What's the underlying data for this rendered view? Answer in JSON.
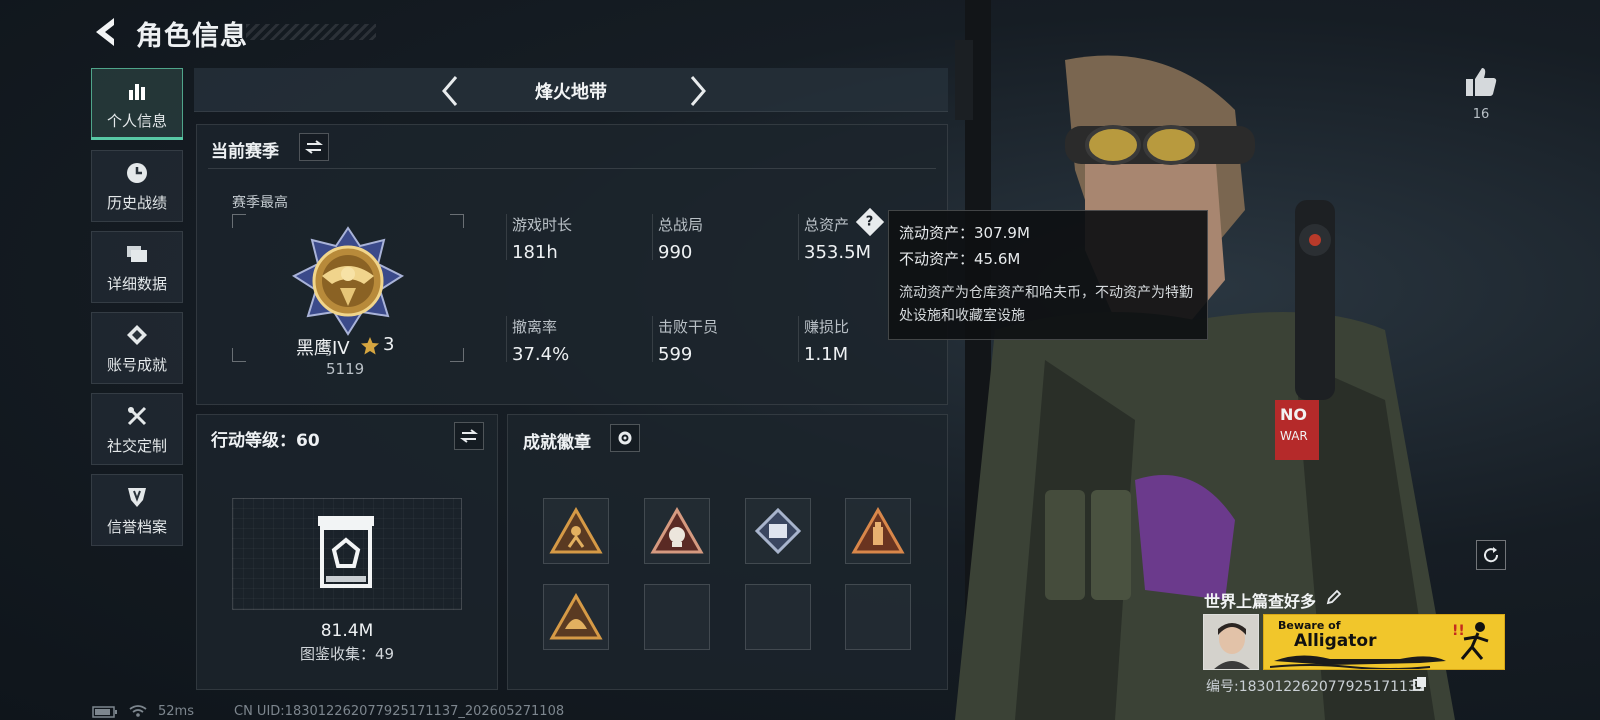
{
  "header": {
    "title": "角色信息"
  },
  "nav": [
    {
      "label": "个人信息",
      "icon": "bar-chart-icon",
      "active": true
    },
    {
      "label": "历史战绩",
      "icon": "clock-icon",
      "active": false
    },
    {
      "label": "详细数据",
      "icon": "folder-icon",
      "active": false
    },
    {
      "label": "账号成就",
      "icon": "achievement-icon",
      "active": false
    },
    {
      "label": "社交定制",
      "icon": "tools-icon",
      "active": false
    },
    {
      "label": "信誉档案",
      "icon": "shield-icon",
      "active": false
    }
  ],
  "mode": {
    "name": "烽火地带"
  },
  "season": {
    "title": "当前赛季",
    "best_label": "赛季最高",
    "rank_name": "黑鹰IV",
    "rank_stars": "3",
    "rank_points": "5119",
    "stats": [
      {
        "label": "游戏时长",
        "value": "181h"
      },
      {
        "label": "总战局",
        "value": "990"
      },
      {
        "label": "总资产",
        "value": "353.5M"
      },
      {
        "label": "撤离率",
        "value": "37.4%"
      },
      {
        "label": "击败干员",
        "value": "599"
      },
      {
        "label": "赚损比",
        "value": "1.1M"
      }
    ]
  },
  "tooltip": {
    "liquid_label": "流动资产：",
    "liquid_value": "307.9M",
    "fixed_label": "不动资产：",
    "fixed_value": "45.6M",
    "description": "流动资产为仓库资产和哈夫币，不动资产为特勤处设施和收藏室设施"
  },
  "action_level": {
    "title_label": "行动等级：",
    "level": "60",
    "value": "81.4M",
    "collection_label": "图鉴收集：",
    "collection_count": "49"
  },
  "achievements": {
    "title": "成就徽章",
    "badges": [
      "triangle-badge-runner",
      "triangle-badge-skull",
      "diamond-badge-scroll",
      "triangle-badge-bottle",
      "triangle-badge-helmet",
      "",
      "",
      ""
    ]
  },
  "like": {
    "count": "16"
  },
  "player": {
    "name": "世界上篇查好多",
    "banner_line1": "Beware of",
    "banner_line2": "Alligator",
    "id_label": "编号:",
    "id_value": "18301226207792517113​7"
  },
  "status": {
    "ping": "52ms",
    "uid": "CN UID:18301226207792517113​7_202605271108"
  },
  "colors": {
    "accent": "#58c9a5",
    "gold": "#d6a640",
    "banner": "#f1c62b"
  }
}
